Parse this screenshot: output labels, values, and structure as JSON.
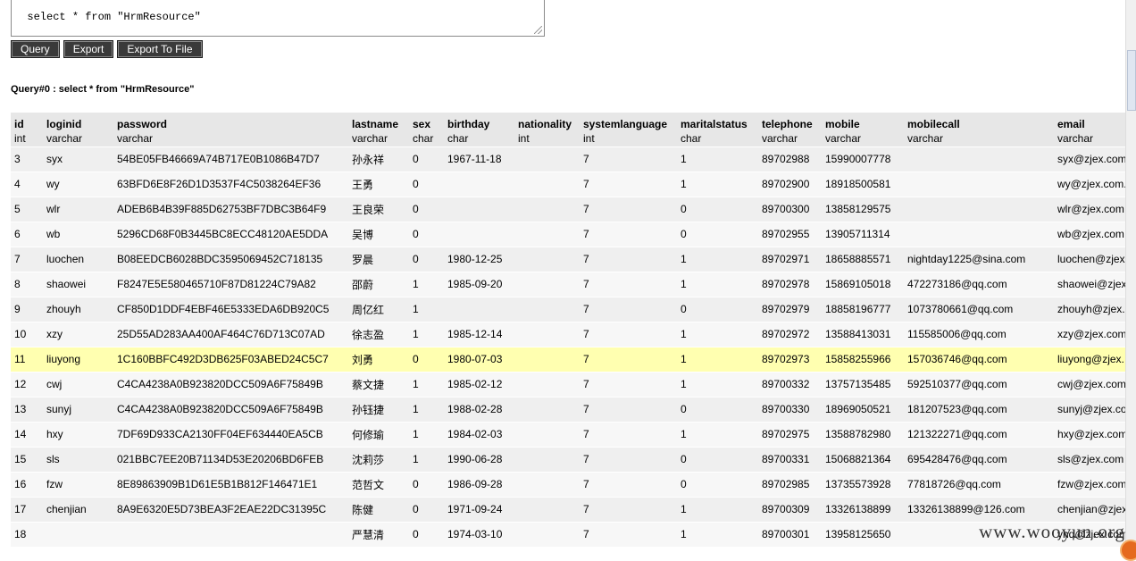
{
  "sql": {
    "text": "select * from \"HrmResource\""
  },
  "buttons": {
    "query": "Query",
    "export": "Export",
    "export_file": "Export To File"
  },
  "query_label": "Query#0 : select * from \"HrmResource\"",
  "columns": [
    {
      "name": "id",
      "type": "int"
    },
    {
      "name": "loginid",
      "type": "varchar"
    },
    {
      "name": "password",
      "type": "varchar"
    },
    {
      "name": "lastname",
      "type": "varchar"
    },
    {
      "name": "sex",
      "type": "char"
    },
    {
      "name": "birthday",
      "type": "char"
    },
    {
      "name": "nationality",
      "type": "int"
    },
    {
      "name": "systemlanguage",
      "type": "int"
    },
    {
      "name": "maritalstatus",
      "type": "char"
    },
    {
      "name": "telephone",
      "type": "varchar"
    },
    {
      "name": "mobile",
      "type": "varchar"
    },
    {
      "name": "mobilecall",
      "type": "varchar"
    },
    {
      "name": "email",
      "type": "varchar"
    }
  ],
  "rows": [
    [
      "3",
      "syx",
      "54BE05FB46669A74B717E0B1086B47D7",
      "孙永祥",
      "0",
      "1967-11-18",
      "",
      "7",
      "1",
      "89702988",
      "15990007778",
      "",
      "syx@zjex.com"
    ],
    [
      "4",
      "wy",
      "63BFD6E8F26D1D3537F4C5038264EF36",
      "王勇",
      "0",
      "",
      "",
      "7",
      "1",
      "89702900",
      "18918500581",
      "",
      "wy@zjex.com."
    ],
    [
      "5",
      "wlr",
      "ADEB6B4B39F885D62753BF7DBC3B64F9",
      "王良荣",
      "0",
      "",
      "",
      "7",
      "0",
      "89700300",
      "13858129575",
      "",
      "wlr@zjex.com"
    ],
    [
      "6",
      "wb",
      "5296CD68F0B3445BC8ECC48120AE5DDA",
      "吴博",
      "0",
      "",
      "",
      "7",
      "0",
      "89702955",
      "13905711314",
      "",
      "wb@zjex.com"
    ],
    [
      "7",
      "luochen",
      "B08EEDCB6028BDC3595069452C718135",
      "罗晨",
      "0",
      "1980-12-25",
      "",
      "7",
      "1",
      "89702971",
      "18658885571",
      "nightday1225@sina.com",
      "luochen@zjex"
    ],
    [
      "8",
      "shaowei",
      "F8247E5E580465710F87D81224C79A82",
      "邵蔚",
      "1",
      "1985-09-20",
      "",
      "7",
      "1",
      "89702978",
      "15869105018",
      "472273186@qq.com",
      "shaowei@zjex"
    ],
    [
      "9",
      "zhouyh",
      "CF850D1DDF4EBF46E5333EDA6DB920C5",
      "周亿红",
      "1",
      "",
      "",
      "7",
      "0",
      "89702979",
      "18858196777",
      "1073780661@qq.com",
      "zhouyh@zjex.c"
    ],
    [
      "10",
      "xzy",
      "25D55AD283AA400AF464C76D713C07AD",
      "徐志盈",
      "1",
      "1985-12-14",
      "",
      "7",
      "1",
      "89702972",
      "13588413031",
      "115585006@qq.com",
      "xzy@zjex.com"
    ],
    [
      "11",
      "liuyong",
      "1C160BBFC492D3DB625F03ABED24C5C7",
      "刘勇",
      "0",
      "1980-07-03",
      "",
      "7",
      "1",
      "89702973",
      "15858255966",
      "157036746@qq.com",
      "liuyong@zjex."
    ],
    [
      "12",
      "cwj",
      "C4CA4238A0B923820DCC509A6F75849B",
      "蔡文捷",
      "1",
      "1985-02-12",
      "",
      "7",
      "1",
      "89700332",
      "13757135485",
      "592510377@qq.com",
      "cwj@zjex.com"
    ],
    [
      "13",
      "sunyj",
      "C4CA4238A0B923820DCC509A6F75849B",
      "孙钰捷",
      "1",
      "1988-02-28",
      "",
      "7",
      "0",
      "89700330",
      "18969050521",
      "181207523@qq.com",
      "sunyj@zjex.co"
    ],
    [
      "14",
      "hxy",
      "7DF69D933CA2130FF04EF634440EA5CB",
      "何修瑜",
      "1",
      "1984-02-03",
      "",
      "7",
      "1",
      "89702975",
      "13588782980",
      "121322271@qq.com",
      "hxy@zjex.com"
    ],
    [
      "15",
      "sls",
      "021BBC7EE20B71134D53E20206BD6FEB",
      "沈莉莎",
      "1",
      "1990-06-28",
      "",
      "7",
      "0",
      "89700331",
      "15068821364",
      "695428476@qq.com",
      "sls@zjex.com"
    ],
    [
      "16",
      "fzw",
      "8E89863909B1D61E5B1B812F146471E1",
      "范哲文",
      "0",
      "1986-09-28",
      "",
      "7",
      "0",
      "89702985",
      "13735573928",
      "77818726@qq.com",
      "fzw@zjex.com"
    ],
    [
      "17",
      "chenjian",
      "8A9E6320E5D73BEA3F2EAE22DC31395C",
      "陈健",
      "0",
      "1971-09-24",
      "",
      "7",
      "1",
      "89700309",
      "13326138899",
      "13326138899@126.com",
      "chenjian@zjex"
    ],
    [
      "18",
      "",
      "",
      "严慧清",
      "0",
      "1974-03-10",
      "",
      "7",
      "1",
      "89700301",
      "13958125650",
      "",
      "yhq@zjex.com"
    ]
  ],
  "highlighted_row_index": 8,
  "watermark": "www.wooyun.org",
  "colors": {
    "highlight": "#ffffb0",
    "header_bg": "#e7e7e7",
    "button_bg": "#3a3a3a"
  }
}
